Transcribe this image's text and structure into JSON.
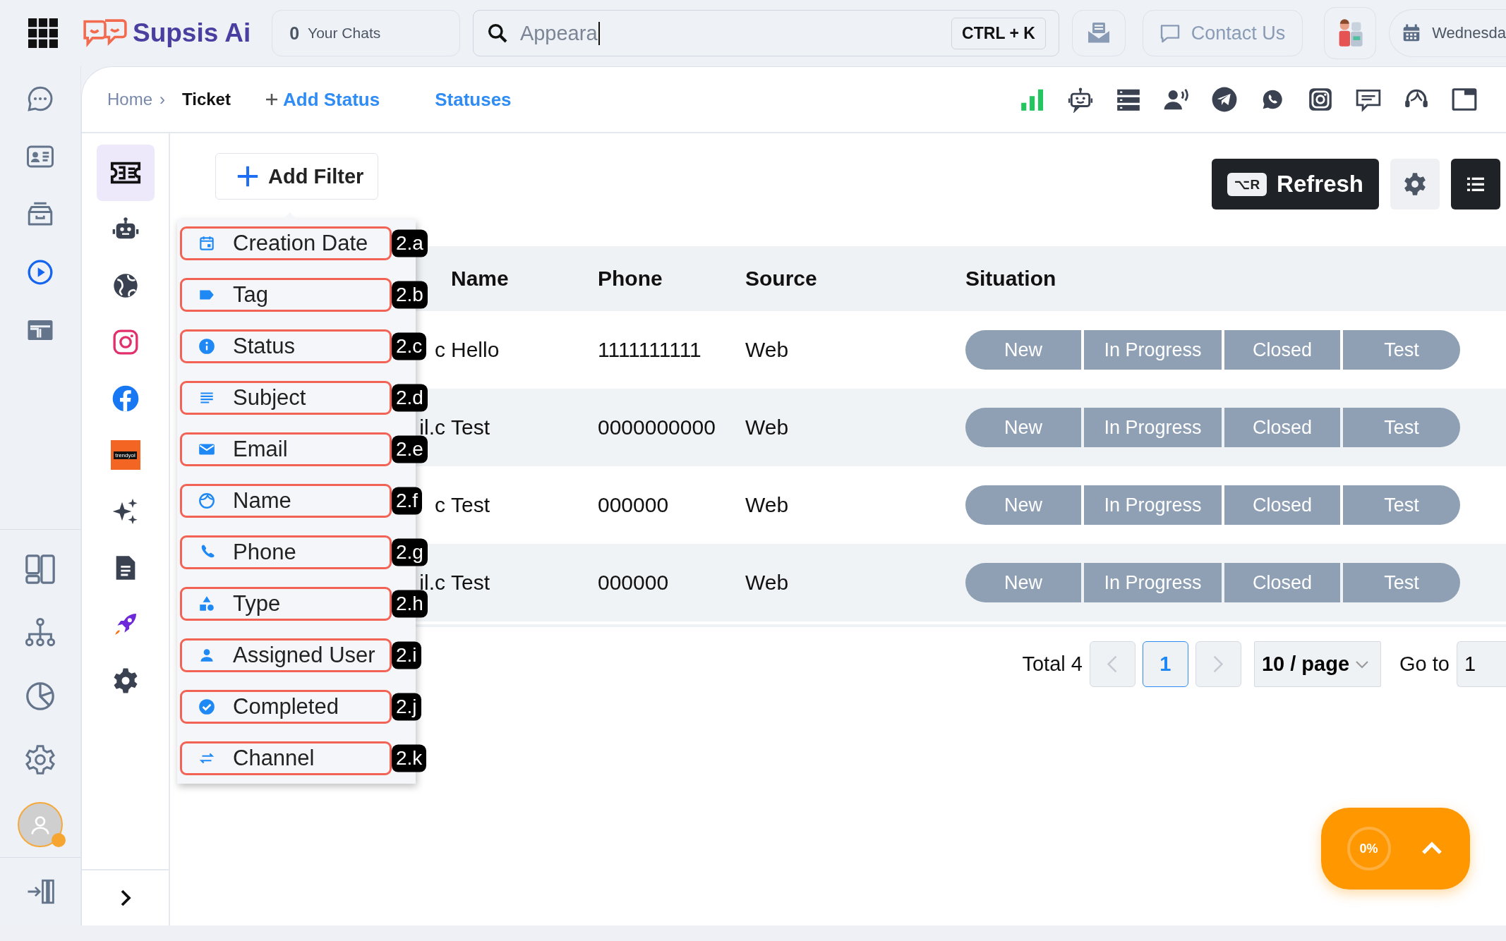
{
  "topbar": {
    "brand": "Supsis Ai",
    "chats": {
      "count": "0",
      "label": "Your Chats"
    },
    "search": {
      "value": "Appeara",
      "shortcut": "CTRL + K"
    },
    "contact": "Contact Us",
    "date": "Wednesda"
  },
  "rail": {
    "items": [
      {
        "selected": false
      },
      {
        "selected": false
      },
      {
        "selected": false
      },
      {
        "selected": true
      },
      {
        "selected": false
      }
    ],
    "bottom_items": [
      {
        "selected": false
      },
      {
        "selected": false
      },
      {
        "selected": false
      },
      {
        "selected": false
      }
    ],
    "user": {
      "online": true
    }
  },
  "breadcrumb": {
    "home": "Home",
    "separator": "›",
    "current": "Ticket"
  },
  "header_links": {
    "add_status": "Add Status",
    "statuses": "Statuses"
  },
  "side_nav": {
    "items": [
      {
        "selected": true
      },
      {
        "selected": false
      },
      {
        "selected": false
      },
      {
        "selected": false
      },
      {
        "selected": false
      },
      {
        "selected": false,
        "label": "trendyol"
      },
      {
        "selected": false
      },
      {
        "selected": false
      },
      {
        "selected": false
      },
      {
        "selected": false
      }
    ]
  },
  "add_filter": "Add Filter",
  "filter_menu": {
    "items": [
      {
        "label": "Creation Date",
        "marker": "2.a"
      },
      {
        "label": "Tag",
        "marker": "2.b"
      },
      {
        "label": "Status",
        "marker": "2.c"
      },
      {
        "label": "Subject",
        "marker": "2.d"
      },
      {
        "label": "Email",
        "marker": "2.e"
      },
      {
        "label": "Name",
        "marker": "2.f"
      },
      {
        "label": "Phone",
        "marker": "2.g"
      },
      {
        "label": "Type",
        "marker": "2.h"
      },
      {
        "label": "Assigned User",
        "marker": "2.i"
      },
      {
        "label": "Completed",
        "marker": "2.j"
      },
      {
        "label": "Channel",
        "marker": "2.k"
      }
    ]
  },
  "toolbar": {
    "refresh": {
      "shortcut": "⌥R",
      "label": "Refresh"
    }
  },
  "table": {
    "columns": [
      "Name",
      "Phone",
      "Source",
      "Situation"
    ],
    "rows": [
      {
        "column_1": "c",
        "name": "Hello",
        "phone": "1111111111",
        "source": "Web",
        "situation": [
          "New",
          "In Progress",
          "Closed",
          "Test"
        ]
      },
      {
        "column_1": "il.c",
        "name": "Test",
        "phone": "0000000000",
        "source": "Web",
        "situation": [
          "New",
          "In Progress",
          "Closed",
          "Test"
        ]
      },
      {
        "column_1": "c",
        "name": "Test",
        "phone": "000000",
        "source": "Web",
        "situation": [
          "New",
          "In Progress",
          "Closed",
          "Test"
        ]
      },
      {
        "column_1": "il.c",
        "name": "Test",
        "phone": "000000",
        "source": "Web",
        "situation": [
          "New",
          "In Progress",
          "Closed",
          "Test"
        ]
      }
    ]
  },
  "pagination": {
    "total": "Total 4",
    "pages": [
      {
        "label": "1",
        "selected": true
      }
    ],
    "page_size": "10 / page",
    "goto_label": "Go to",
    "goto_value": "1"
  },
  "progress_widget": {
    "progress": "0%"
  }
}
